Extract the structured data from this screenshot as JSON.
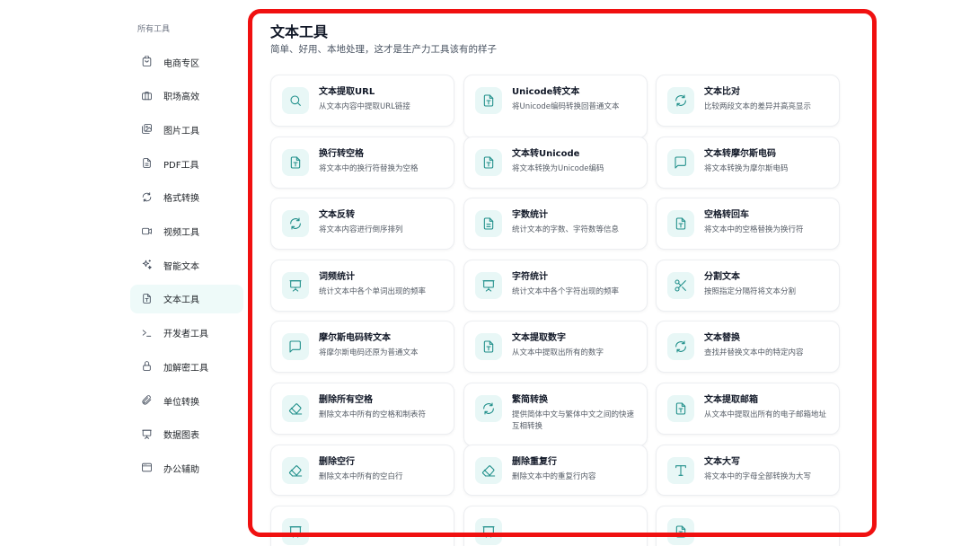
{
  "sidebar": {
    "title": "所有工具",
    "items": [
      {
        "label": "电商专区",
        "icon": "shopping-bag-icon"
      },
      {
        "label": "职场高效",
        "icon": "briefcase-icon"
      },
      {
        "label": "图片工具",
        "icon": "images-icon"
      },
      {
        "label": "PDF工具",
        "icon": "file-text-icon"
      },
      {
        "label": "格式转换",
        "icon": "refresh-icon"
      },
      {
        "label": "视频工具",
        "icon": "video-icon"
      },
      {
        "label": "智能文本",
        "icon": "sparkles-icon"
      },
      {
        "label": "文本工具",
        "icon": "file-type-icon",
        "active": true
      },
      {
        "label": "开发者工具",
        "icon": "terminal-icon"
      },
      {
        "label": "加解密工具",
        "icon": "lock-icon"
      },
      {
        "label": "单位转换",
        "icon": "paperclip-icon"
      },
      {
        "label": "数据图表",
        "icon": "presentation-icon"
      },
      {
        "label": "办公辅助",
        "icon": "browser-window-icon"
      }
    ]
  },
  "main": {
    "title": "文本工具",
    "subtitle": "简单、好用、本地处理，这才是生产力工具该有的样子",
    "accent_color": "#1f8f8a",
    "highlight_color": "#f01010",
    "cards": [
      {
        "title": "文本提取URL",
        "desc": "从文本内容中提取URL链接",
        "icon": "search-icon"
      },
      {
        "title": "Unicode转文本",
        "desc": "将Unicode编码转换回普通文本",
        "icon": "file-type-icon"
      },
      {
        "title": "文本比对",
        "desc": "比较两段文本的差异并高亮显示",
        "icon": "refresh-icon"
      },
      {
        "title": "换行转空格",
        "desc": "将文本中的换行符替换为空格",
        "icon": "file-type-icon"
      },
      {
        "title": "文本转Unicode",
        "desc": "将文本转换为Unicode编码",
        "icon": "file-type-icon"
      },
      {
        "title": "文本转摩尔斯电码",
        "desc": "将文本转换为摩尔斯电码",
        "icon": "message-square-icon"
      },
      {
        "title": "文本反转",
        "desc": "将文本内容进行倒序排列",
        "icon": "refresh-icon"
      },
      {
        "title": "字数统计",
        "desc": "统计文本的字数、字符数等信息",
        "icon": "file-text-icon"
      },
      {
        "title": "空格转回车",
        "desc": "将文本中的空格替换为换行符",
        "icon": "file-type-icon"
      },
      {
        "title": "词频统计",
        "desc": "统计文本中各个单词出现的频率",
        "icon": "presentation-icon"
      },
      {
        "title": "字符统计",
        "desc": "统计文本中各个字符出现的频率",
        "icon": "presentation-icon"
      },
      {
        "title": "分割文本",
        "desc": "按照指定分隔符将文本分割",
        "icon": "scissors-icon"
      },
      {
        "title": "摩尔斯电码转文本",
        "desc": "将摩尔斯电码还原为普通文本",
        "icon": "message-square-icon"
      },
      {
        "title": "文本提取数字",
        "desc": "从文本中提取出所有的数字",
        "icon": "file-type-icon"
      },
      {
        "title": "文本替换",
        "desc": "查找并替换文本中的特定内容",
        "icon": "refresh-icon"
      },
      {
        "title": "删除所有空格",
        "desc": "删除文本中所有的空格和制表符",
        "icon": "eraser-icon"
      },
      {
        "title": "繁简转换",
        "desc": "提供简体中文与繁体中文之间的快速互相转换",
        "icon": "refresh-icon"
      },
      {
        "title": "文本提取邮箱",
        "desc": "从文本中提取出所有的电子邮箱地址",
        "icon": "file-type-icon"
      },
      {
        "title": "删除空行",
        "desc": "删除文本中所有的空白行",
        "icon": "eraser-icon"
      },
      {
        "title": "删除重复行",
        "desc": "删除文本中的重复行内容",
        "icon": "eraser-icon"
      },
      {
        "title": "文本大写",
        "desc": "将文本中的字母全部转换为大写",
        "icon": "type-icon"
      },
      {
        "title": "",
        "desc": "",
        "icon": "presentation-icon"
      },
      {
        "title": "",
        "desc": "",
        "icon": "presentation-icon"
      },
      {
        "title": "",
        "desc": "",
        "icon": "file-type-icon"
      }
    ]
  }
}
